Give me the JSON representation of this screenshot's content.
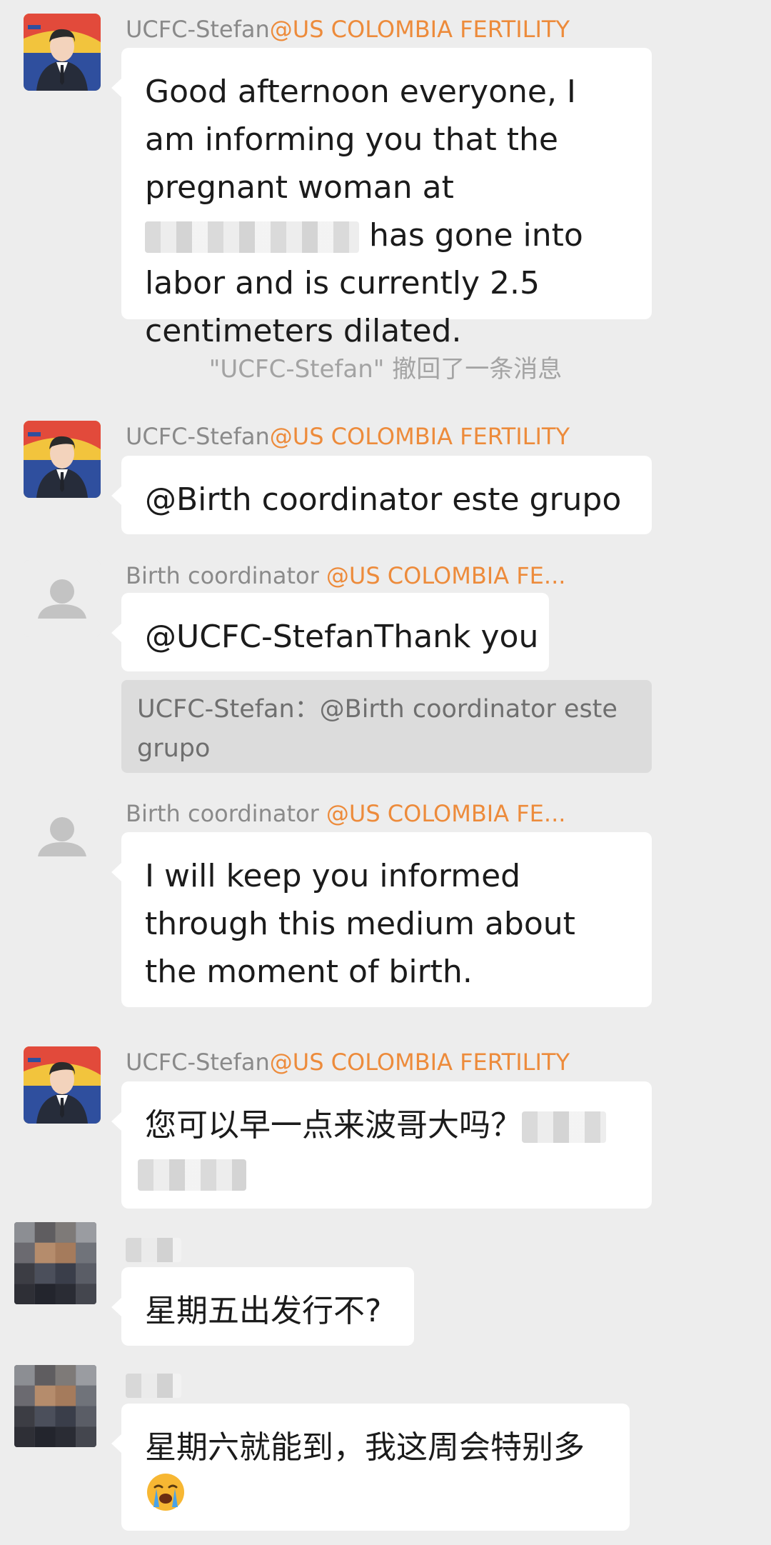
{
  "messages": [
    {
      "sender": "UCFC-Stefan",
      "org": "@US COLOMBIA FERTILITY",
      "text_before": "Good afternoon everyone, I am informing you that the pregnant woman at",
      "text_after": "has gone into labor and is currently 2.5 centimeters dilated."
    },
    {
      "system": "\"UCFC-Stefan\" 撤回了一条消息"
    },
    {
      "sender": "UCFC-Stefan",
      "org": "@US COLOMBIA FERTILITY",
      "text": "@Birth coordinator  este grupo"
    },
    {
      "sender": "Birth coordinator",
      "org": "@US COLOMBIA FE...",
      "text": "@UCFC-StefanThank you",
      "quote": "UCFC-Stefan：@Birth coordinator  este grupo"
    },
    {
      "sender": "Birth coordinator",
      "org": "@US COLOMBIA FE...",
      "text": "I will keep you informed through this medium about the moment of birth."
    },
    {
      "sender": "UCFC-Stefan",
      "org": "@US COLOMBIA FERTILITY",
      "text": "您可以早一点来波哥大吗？"
    },
    {
      "text": "星期五出发行不?"
    },
    {
      "text": "星期六就能到，我这周会特别多"
    }
  ],
  "icons": {
    "avatar_stefan": "suited-man-avatar-icon",
    "avatar_default": "default-person-icon",
    "emoji": "loudly-crying-face-icon"
  },
  "colors": {
    "background": "#ededed",
    "bubble": "#ffffff",
    "org_tag": "#ed8b3b",
    "sender_name": "#8a8a8a"
  }
}
